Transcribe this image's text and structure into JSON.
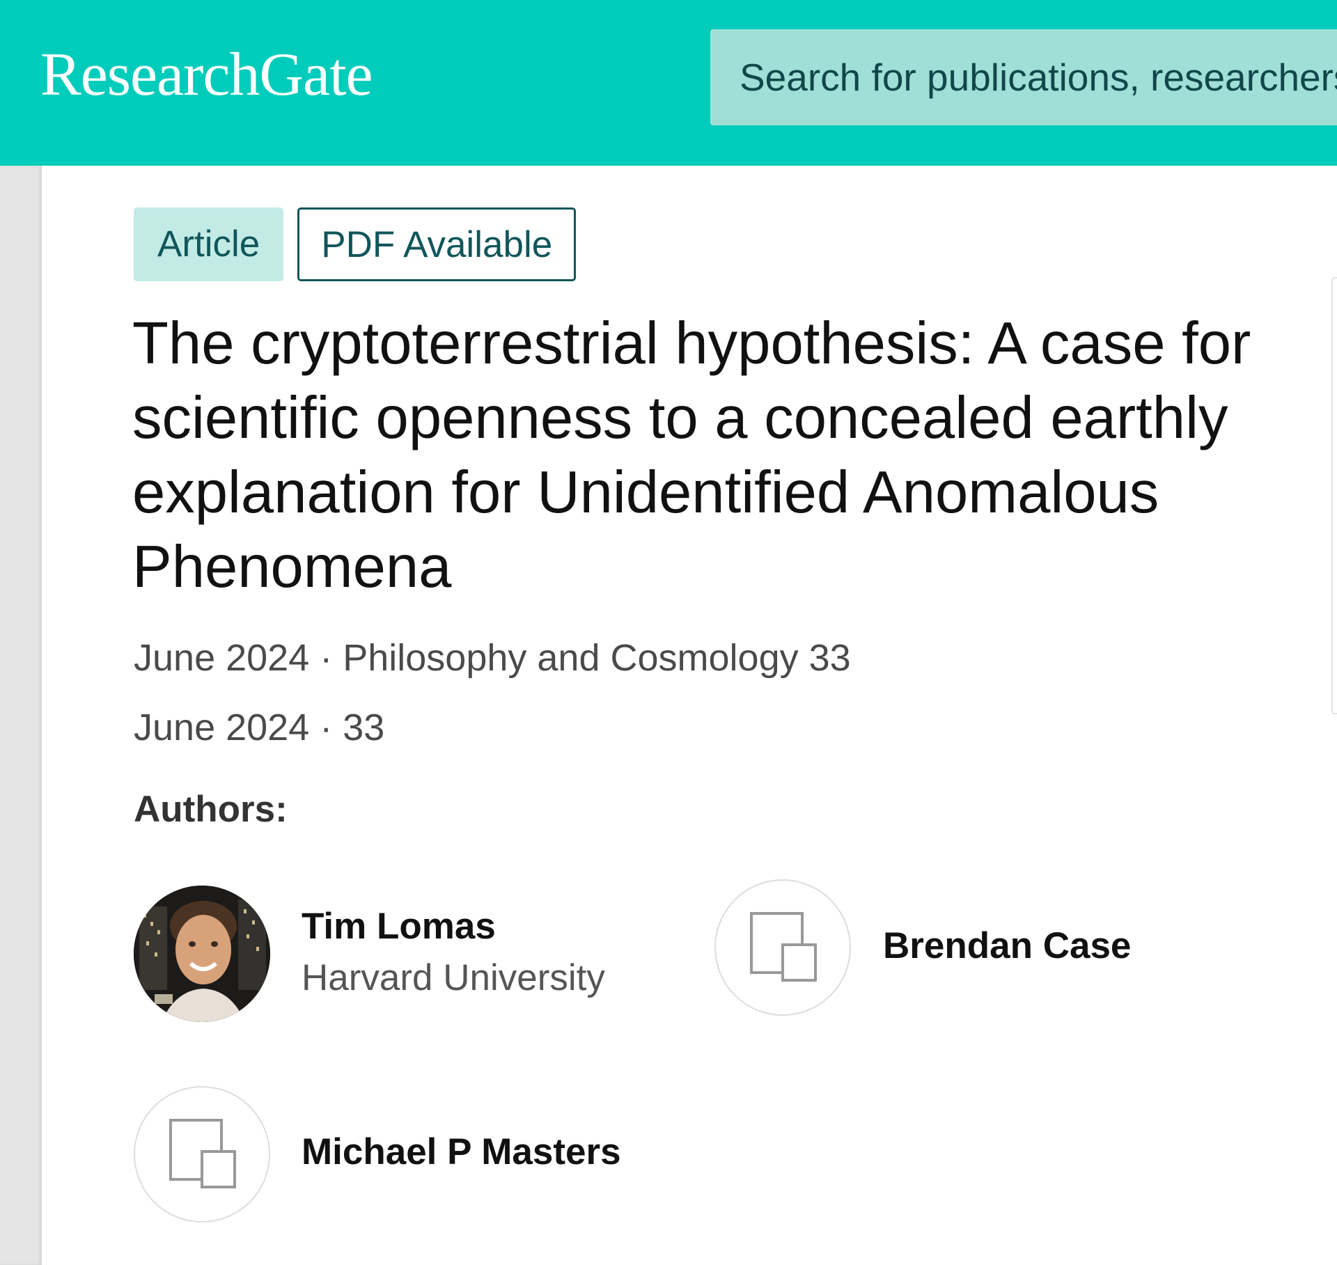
{
  "header": {
    "logo_text": "ResearchGate",
    "search_placeholder": "Search for publications, researchers, or questions",
    "brand_color": "#00ccbb"
  },
  "publication": {
    "badges": [
      "Article",
      "PDF Available"
    ],
    "title": "The cryptoterrestrial hypothesis: A case for scientific openness to a concealed earthly explanation for Unidentified Anomalous Phenomena",
    "meta_line_1": "June 2024 · Philosophy and Cosmology 33",
    "meta_line_2": "June 2024 · 33",
    "authors_label": "Authors:",
    "authors": [
      {
        "name": "Tim Lomas",
        "affiliation": "Harvard University",
        "avatar": "profile-photo"
      },
      {
        "name": "Brendan Case",
        "affiliation": "",
        "avatar": "placeholder-profile-icon"
      },
      {
        "name": "Michael P Masters",
        "affiliation": "",
        "avatar": "placeholder-profile-icon"
      }
    ]
  }
}
